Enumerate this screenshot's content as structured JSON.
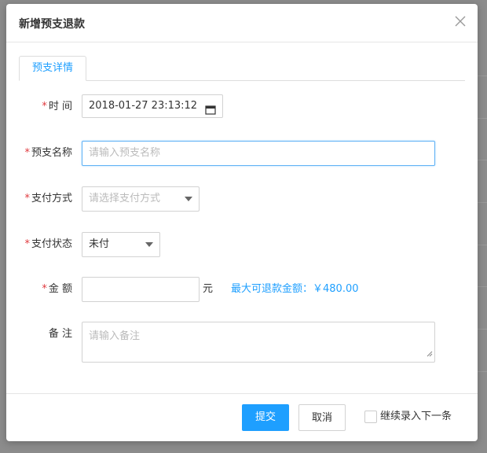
{
  "dialog": {
    "title": "新增预支退款",
    "tab_label": "预支详情"
  },
  "form": {
    "time": {
      "label": "时 间",
      "value": "2018-01-27 23:13:12",
      "required": true
    },
    "name": {
      "label": "预支名称",
      "placeholder": "请输入预支名称",
      "required": true
    },
    "pay_method": {
      "label": "支付方式",
      "placeholder": "请选择支付方式",
      "required": true
    },
    "pay_status": {
      "label": "支付状态",
      "value": "未付",
      "required": true
    },
    "amount": {
      "label": "金 额",
      "unit": "元",
      "max_hint": "最大可退款金额：￥480.00",
      "required": true
    },
    "remark": {
      "label": "备 注",
      "placeholder": "请输入备注",
      "required": false
    }
  },
  "footer": {
    "submit_label": "提交",
    "cancel_label": "取消",
    "continue_label": "继续录入下一条",
    "continue_checked": false
  },
  "colors": {
    "primary": "#1e9fff",
    "required": "#e0393e",
    "overlay": "#8c8c8c"
  },
  "icons": [
    "close-icon",
    "calendar-icon",
    "chevron-down-icon",
    "resize-grip-icon"
  ]
}
